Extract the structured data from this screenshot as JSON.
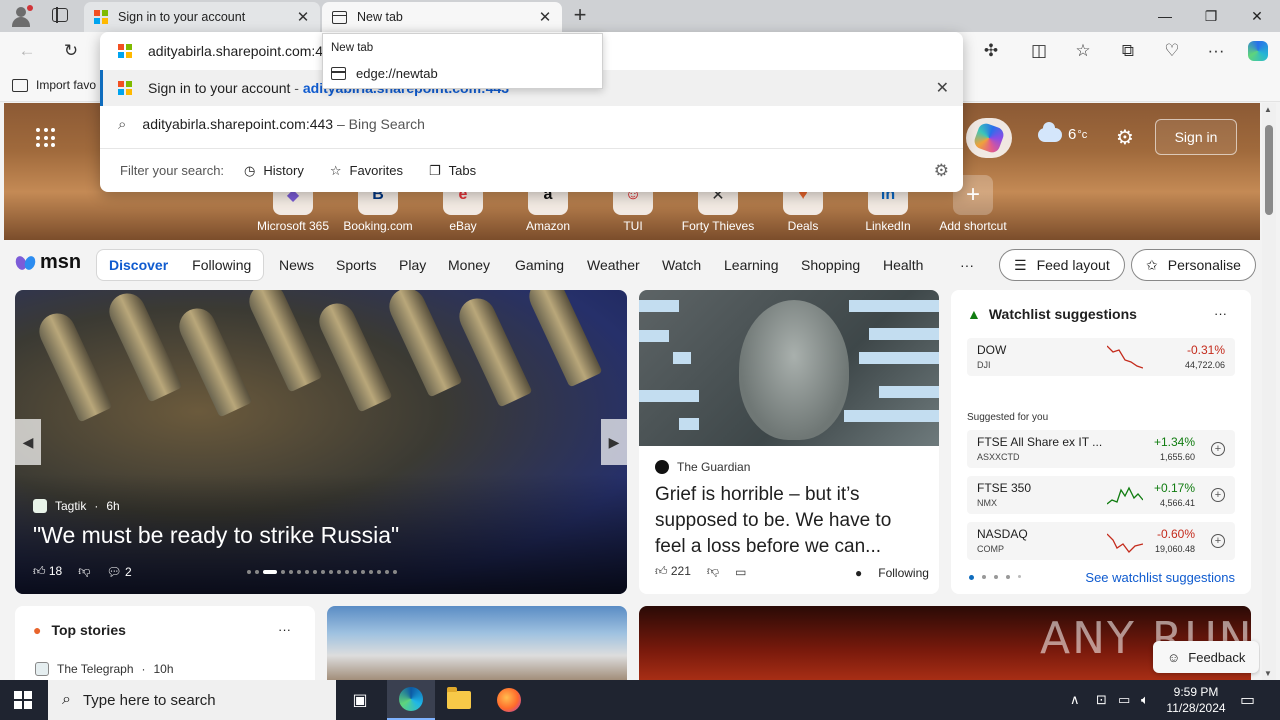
{
  "browser": {
    "tabs": [
      {
        "title": "Sign in to your account",
        "close": "✕"
      },
      {
        "title": "New tab",
        "close": "✕"
      }
    ],
    "new_tab_button": "+",
    "window_controls": {
      "minimize": "—",
      "maximize": "❐",
      "close": "✕"
    },
    "bookmarks_bar": {
      "import_label": "Import favo"
    },
    "tab_tooltip": {
      "title": "New tab",
      "url": "edge://newtab"
    }
  },
  "omnibox": {
    "input_value": "adityabirla.sharepoint.com:443",
    "suggestions": [
      {
        "title": "Sign in to your account",
        "separator": " - ",
        "url": "adityabirla.sharepoint.com:443"
      },
      {
        "query": "adityabirla.sharepoint.com:443",
        "source": " – Bing Search"
      }
    ],
    "filter": {
      "label": "Filter your search:",
      "chips": [
        "History",
        "Favorites",
        "Tabs"
      ]
    }
  },
  "newtab": {
    "weather": {
      "temp": "6",
      "unit": "°c"
    },
    "signin_label": "Sign in",
    "shortcuts": [
      {
        "label": "Microsoft 365",
        "glyph": "◆",
        "color": "#7b5cd6"
      },
      {
        "label": "Booking.com",
        "glyph": "B",
        "color": "#003580"
      },
      {
        "label": "eBay",
        "glyph": "e",
        "color": "#e53238"
      },
      {
        "label": "Amazon",
        "glyph": "a",
        "color": "#111111"
      },
      {
        "label": "TUI",
        "glyph": "☺",
        "color": "#d40e14"
      },
      {
        "label": "Forty Thieves",
        "glyph": "✕",
        "color": "#333333"
      },
      {
        "label": "Deals",
        "glyph": "♥",
        "color": "#e8642c"
      },
      {
        "label": "LinkedIn",
        "glyph": "in",
        "color": "#0a66c2"
      },
      {
        "label": "Add shortcut",
        "glyph": "+",
        "color": "#ffffff"
      }
    ]
  },
  "msn": {
    "logo": "msn",
    "segments": [
      "Discover",
      "Following"
    ],
    "categories": [
      "News",
      "Sports",
      "Play",
      "Money",
      "Gaming",
      "Weather",
      "Watch",
      "Learning",
      "Shopping",
      "Health"
    ],
    "more": "···",
    "feed_layout": "Feed layout",
    "personalise": "Personalise"
  },
  "hero_story": {
    "source": "Tagtik",
    "age": "6h",
    "title": "\"We must be ready to strike Russia\"",
    "likes": "18",
    "comments": "2"
  },
  "news_story": {
    "source": "The Guardian",
    "title": "Grief is horrible – but it’s supposed to be. We have to feel a loss before we can...",
    "likes": "221",
    "following": "Following"
  },
  "watchlist": {
    "title": "Watchlist suggestions",
    "more": "···",
    "main": {
      "symbol": "DOW",
      "exchange": "DJI",
      "change": "-0.31%",
      "price": "44,722.06",
      "direction": "down"
    },
    "suggested_label": "Suggested for you",
    "suggested": [
      {
        "symbol": "FTSE All Share ex IT ...",
        "exchange": "ASXXCTD",
        "change": "+1.34%",
        "price": "1,655.60",
        "direction": "up"
      },
      {
        "symbol": "FTSE 350",
        "exchange": "NMX",
        "change": "+0.17%",
        "price": "4,566.41",
        "direction": "up"
      },
      {
        "symbol": "NASDAQ",
        "exchange": "COMP",
        "change": "-0.60%",
        "price": "19,060.48",
        "direction": "down"
      }
    ],
    "see_more": "See watchlist suggestions"
  },
  "top_stories": {
    "title": "Top stories",
    "more": "···",
    "source": "The Telegraph",
    "age": "10h"
  },
  "feedback_label": "Feedback",
  "watermark": "ANY RUN",
  "taskbar": {
    "search_placeholder": "Type here to search",
    "time": "9:59 PM",
    "date": "11/28/2024"
  }
}
